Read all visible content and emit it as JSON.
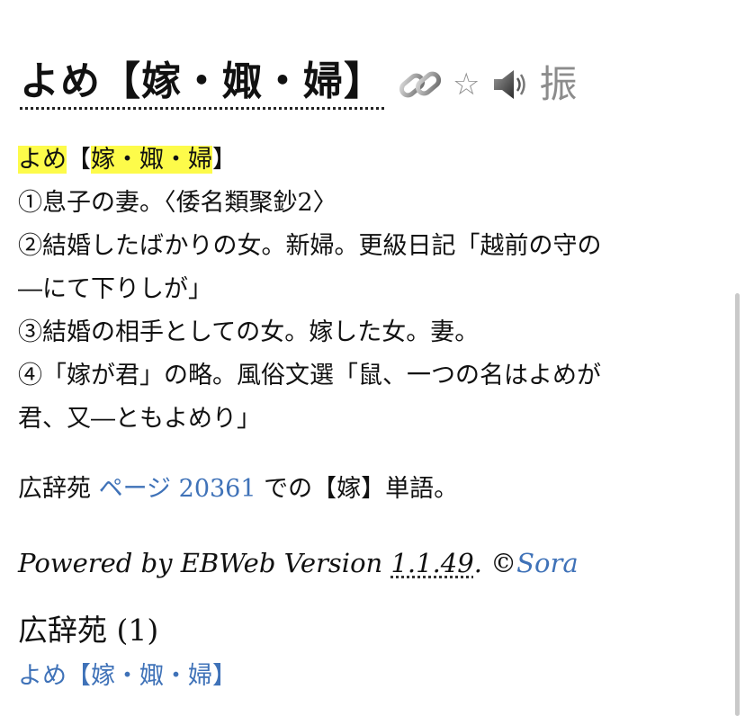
{
  "header": {
    "headword": "よめ【嫁・娵・婦】",
    "tools": {
      "link_icon": "link-icon",
      "star_glyph": "☆",
      "speaker_icon": "speaker-icon",
      "furigana_char": "振"
    }
  },
  "entry": {
    "heading_reading": "よめ",
    "heading_kanji_open": "【",
    "heading_kanji": "嫁・娵・婦",
    "heading_kanji_close": "】",
    "lines": [
      "①息子の妻。〈倭名類聚鈔2〉",
      "②結婚したばかりの女。新婦。更級日記「越前の守の",
      "―にて下りしが」",
      "③結婚の相手としての女。嫁した女。妻。",
      "④「嫁が君」の略。風俗文選「鼠、一つの名はよめが",
      "君、又―ともよめり」"
    ]
  },
  "source": {
    "dict_name": "広辞苑",
    "page_link": "ページ 20361",
    "suffix": "での【嫁】単語。"
  },
  "powered": {
    "prefix": "Powered by EBWeb Version ",
    "version": "1.1.49",
    "copyright_prefix": ". ©",
    "author": "Sora"
  },
  "results": {
    "dict_heading": "広辞苑 (1)",
    "items": [
      "よめ【嫁・娵・婦】"
    ]
  },
  "colors": {
    "highlight": "#fdfb4a",
    "link": "#3f72b8",
    "icon_gray": "#8a8a8a"
  }
}
